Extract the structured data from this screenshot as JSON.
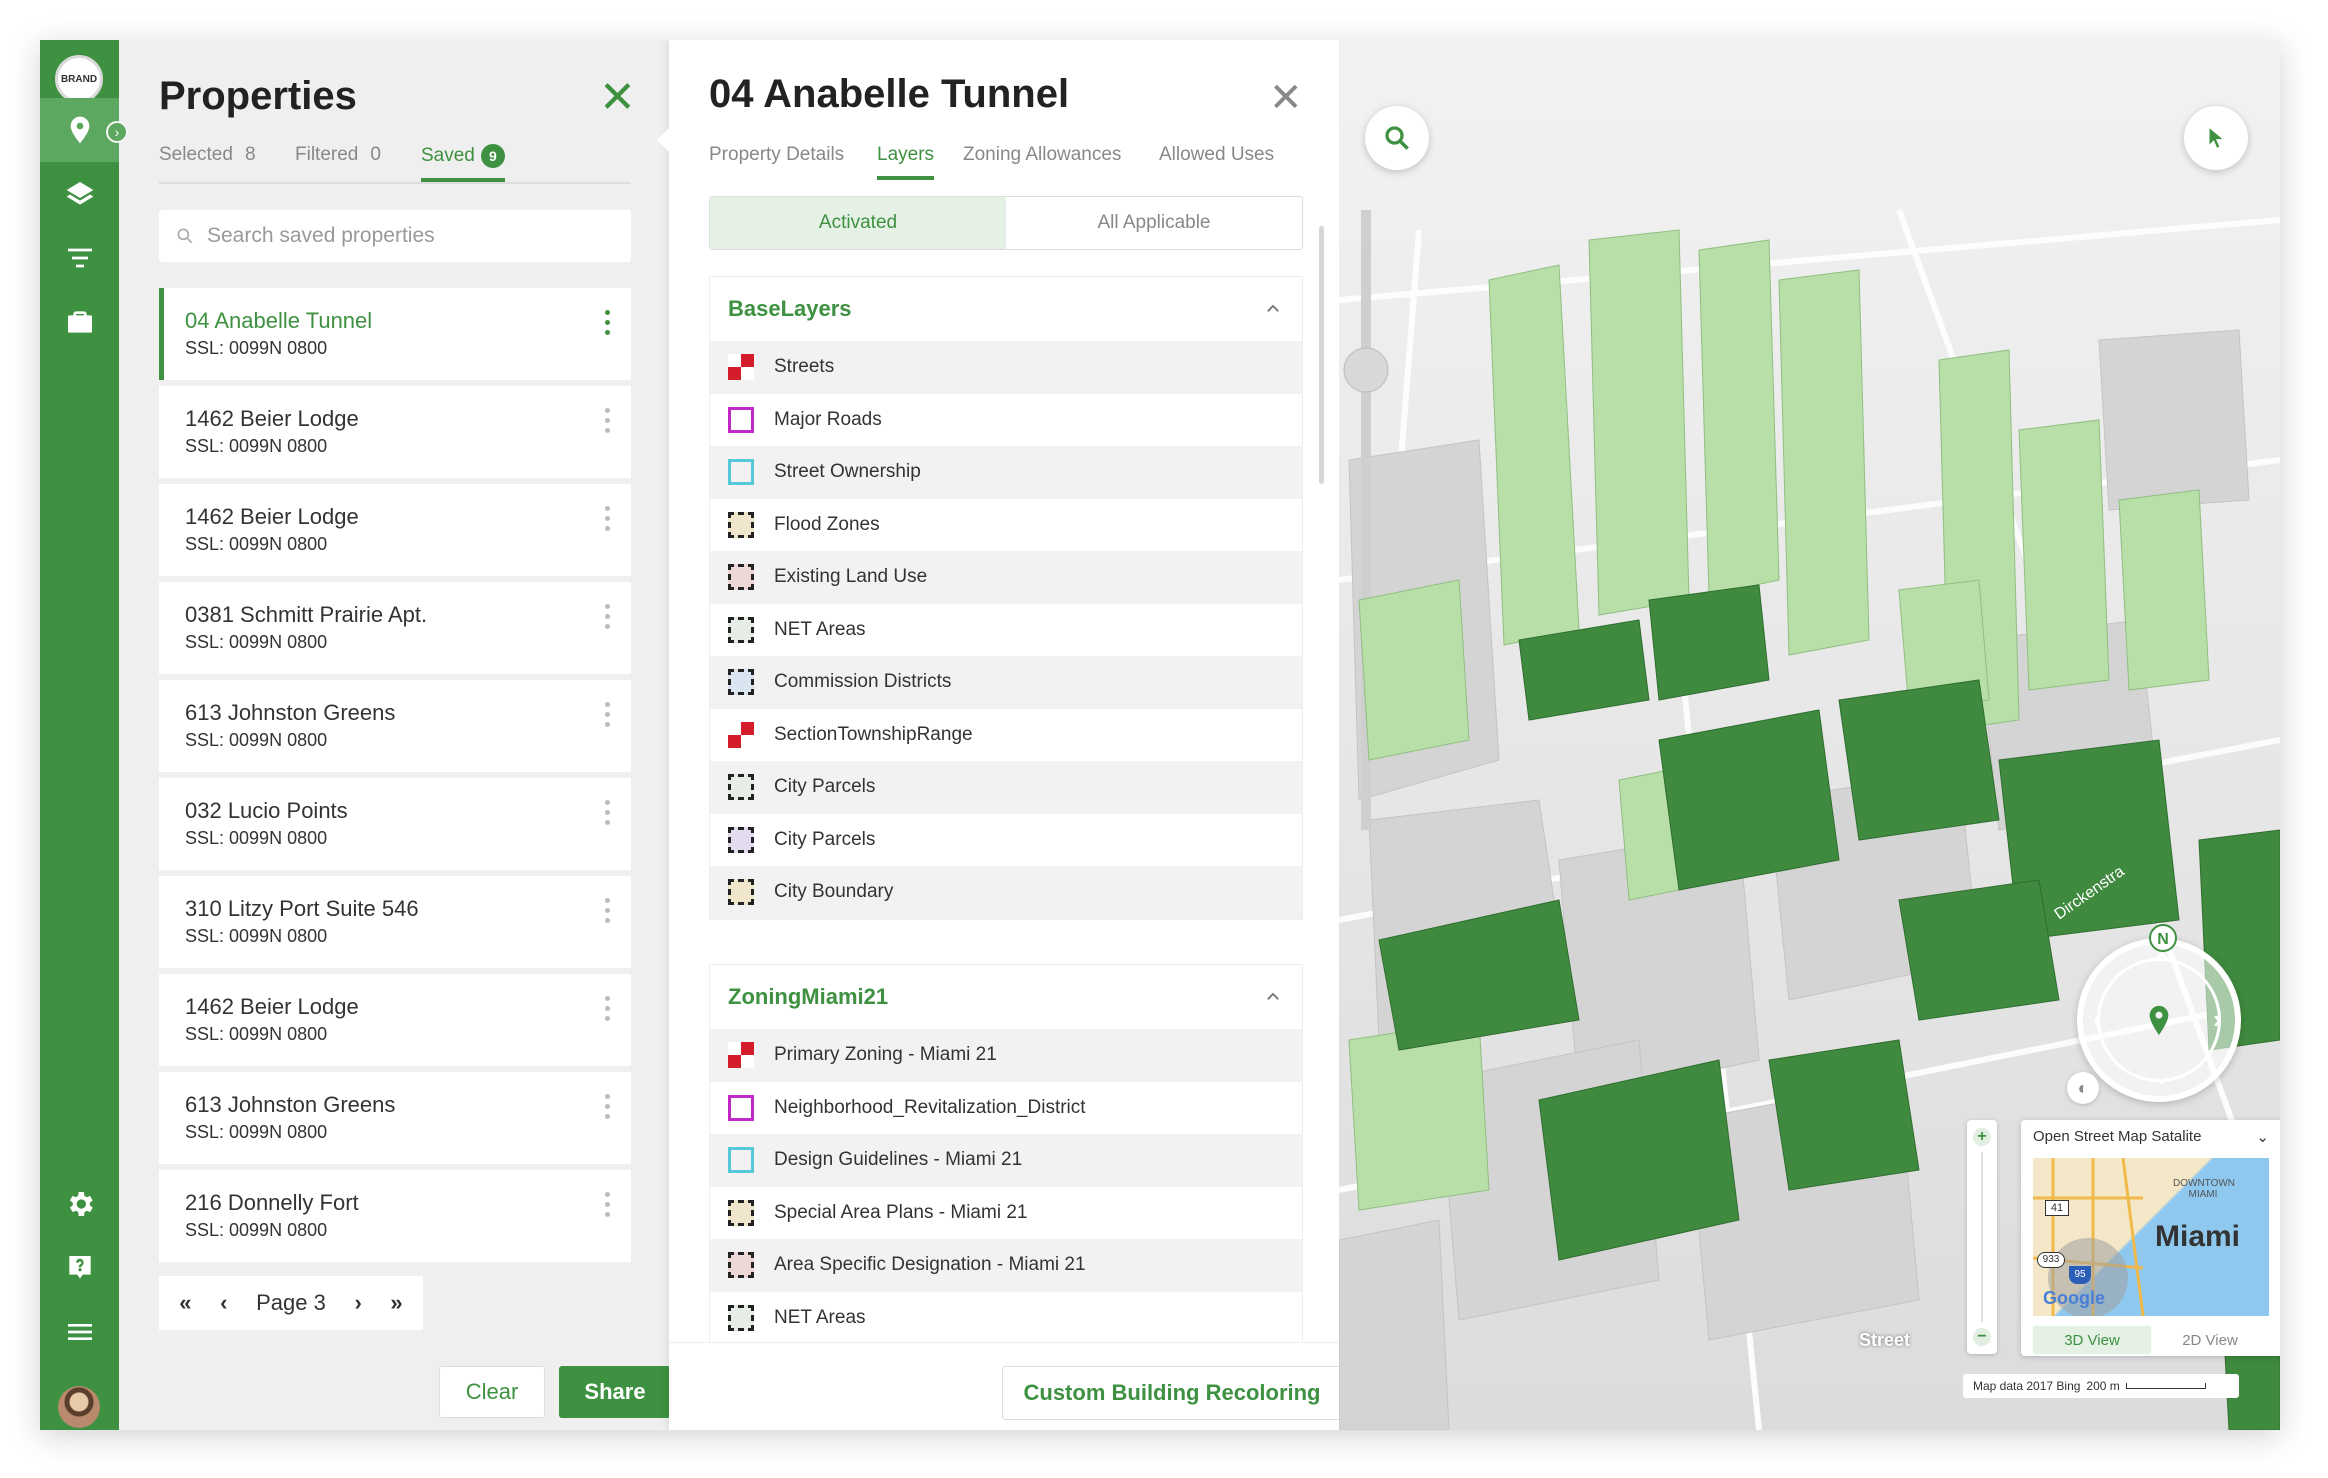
{
  "brand": {
    "logo_text": "BRAND"
  },
  "rail": {
    "items": [
      "location",
      "layers",
      "filter",
      "briefcase"
    ],
    "bottom": [
      "settings",
      "help",
      "menu",
      "avatar"
    ]
  },
  "properties": {
    "title": "Properties",
    "tabs": [
      {
        "label": "Selected",
        "count": "8"
      },
      {
        "label": "Filtered",
        "count": "0"
      },
      {
        "label": "Saved",
        "count": "9"
      }
    ],
    "search_placeholder": "Search saved properties",
    "items": [
      {
        "name": "04 Anabelle Tunnel",
        "ssl": "SSL: 0099N 0800"
      },
      {
        "name": "1462 Beier Lodge",
        "ssl": "SSL: 0099N 0800"
      },
      {
        "name": "1462 Beier Lodge",
        "ssl": "SSL: 0099N 0800"
      },
      {
        "name": "0381 Schmitt Prairie Apt.",
        "ssl": "SSL: 0099N 0800"
      },
      {
        "name": "613 Johnston Greens",
        "ssl": "SSL: 0099N 0800"
      },
      {
        "name": "032 Lucio Points",
        "ssl": "SSL: 0099N 0800"
      },
      {
        "name": "310 Litzy Port Suite 546",
        "ssl": "SSL: 0099N 0800"
      },
      {
        "name": "1462 Beier Lodge",
        "ssl": "SSL: 0099N 0800"
      },
      {
        "name": "613 Johnston Greens",
        "ssl": "SSL: 0099N 0800"
      },
      {
        "name": "216 Donnelly Fort",
        "ssl": "SSL: 0099N 0800"
      }
    ],
    "pager": {
      "label": "Page 3"
    },
    "clear_label": "Clear",
    "share_label": "Share"
  },
  "detail": {
    "title": "04 Anabelle Tunnel",
    "tabs": [
      "Property Details",
      "Layers",
      "Zoning Allowances",
      "Allowed Uses"
    ],
    "segment": [
      "Activated",
      "All Applicable"
    ],
    "sections": [
      {
        "title": "BaseLayers",
        "layers": [
          {
            "label": "Streets",
            "swatch": "red"
          },
          {
            "label": "Major Roads",
            "swatch": "mag"
          },
          {
            "label": "Street Ownership",
            "swatch": "cyan"
          },
          {
            "label": "Flood Zones",
            "swatch": "dash"
          },
          {
            "label": "Existing Land Use",
            "swatch": "dashr"
          },
          {
            "label": "NET Areas",
            "swatch": "dashg"
          },
          {
            "label": "Commission Districts",
            "swatch": "dashb"
          },
          {
            "label": "SectionTownshipRange",
            "swatch": "red"
          },
          {
            "label": "City Parcels",
            "swatch": "dashg"
          },
          {
            "label": "City Parcels",
            "swatch": "dashp"
          },
          {
            "label": "City Boundary",
            "swatch": "dash"
          }
        ]
      },
      {
        "title": "ZoningMiami21",
        "layers": [
          {
            "label": "Primary Zoning - Miami 21",
            "swatch": "red"
          },
          {
            "label": "Neighborhood_Revitalization_District",
            "swatch": "mag"
          },
          {
            "label": "Design Guidelines - Miami 21",
            "swatch": "cyan"
          },
          {
            "label": "Special Area Plans - Miami 21",
            "swatch": "dash"
          },
          {
            "label": "Area Specific Designation - Miami 21",
            "swatch": "dashr"
          },
          {
            "label": "NET Areas",
            "swatch": "dashg"
          }
        ]
      }
    ],
    "custom_button": "Custom Building Recoloring"
  },
  "map": {
    "compass_label": "N",
    "street_label": "Street",
    "minimap": {
      "source": "Open Street Map Satalite",
      "city": "Miami",
      "district": "DOWNTOWN MIAMI",
      "shield_41": "41",
      "shield_933": "933",
      "shield_95": "95",
      "google": "Google",
      "views": [
        "3D View",
        "2D View"
      ]
    },
    "attribution": "Map data 2017 Bing",
    "scale": "200 m",
    "colors": {
      "accent": "#3d9140",
      "building_light": "#b8dfa8",
      "building_dark": "#3f8a3f"
    }
  }
}
